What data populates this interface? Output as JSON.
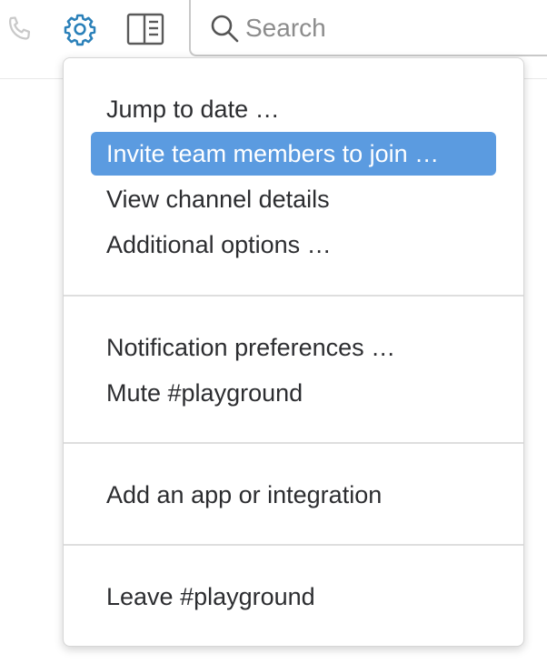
{
  "header": {
    "icons": {
      "phone": "phone-icon",
      "gear": "gear-icon",
      "panel": "panel-toggle-icon",
      "search": "search-icon"
    },
    "search": {
      "placeholder": "Search",
      "value": ""
    }
  },
  "menu": {
    "sections": [
      {
        "items": [
          {
            "label": "Jump to date …"
          },
          {
            "label": "Invite team members to join …",
            "highlighted": true
          },
          {
            "label": "View channel details"
          },
          {
            "label": "Additional options …"
          }
        ]
      },
      {
        "items": [
          {
            "label": "Notification preferences …"
          },
          {
            "label": "Mute #playground"
          }
        ]
      },
      {
        "items": [
          {
            "label": "Add an app or integration"
          }
        ]
      },
      {
        "items": [
          {
            "label": "Leave #playground"
          }
        ]
      }
    ]
  },
  "colors": {
    "highlight": "#5b9be0",
    "accent_icon": "#2a80b9",
    "text": "#2c2d30",
    "divider": "#dedede"
  }
}
